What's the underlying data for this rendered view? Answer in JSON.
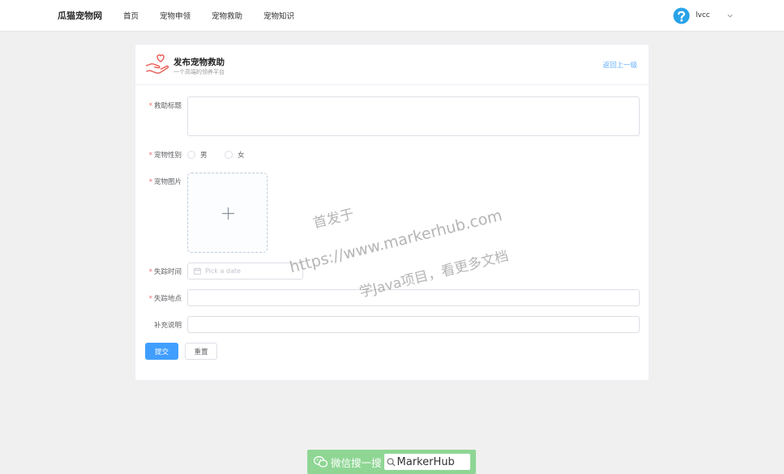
{
  "header": {
    "brand": "瓜猫宠物网",
    "nav": [
      "首页",
      "宠物申领",
      "宠物救助",
      "宠物知识"
    ],
    "username": "lvcc"
  },
  "card": {
    "title": "发布宠物救助",
    "subtitle": "一个高端的领养平台",
    "back": "返回上一级"
  },
  "form": {
    "rescue_title_label": "救助标题",
    "rescue_title_value": "",
    "gender_label": "宠物性别",
    "gender_options": [
      "男",
      "女"
    ],
    "image_label": "宠物图片",
    "lost_time_label": "失踪时间",
    "lost_time_placeholder": "Pick a date",
    "lost_place_label": "失踪地点",
    "lost_place_value": "",
    "note_label": "补充说明",
    "note_value": "",
    "submit": "提交",
    "reset": "重置"
  },
  "watermark": {
    "line1": "首发于",
    "line2": "https://www.markerhub.com",
    "line3": "学Java项目，看更多文档"
  },
  "footer_badge": {
    "text": "微信搜一搜",
    "search": "MarkerHub"
  },
  "colors": {
    "primary": "#409eff",
    "required": "#f56c6c",
    "link": "#66b1ff",
    "badge": "#8fd694"
  }
}
